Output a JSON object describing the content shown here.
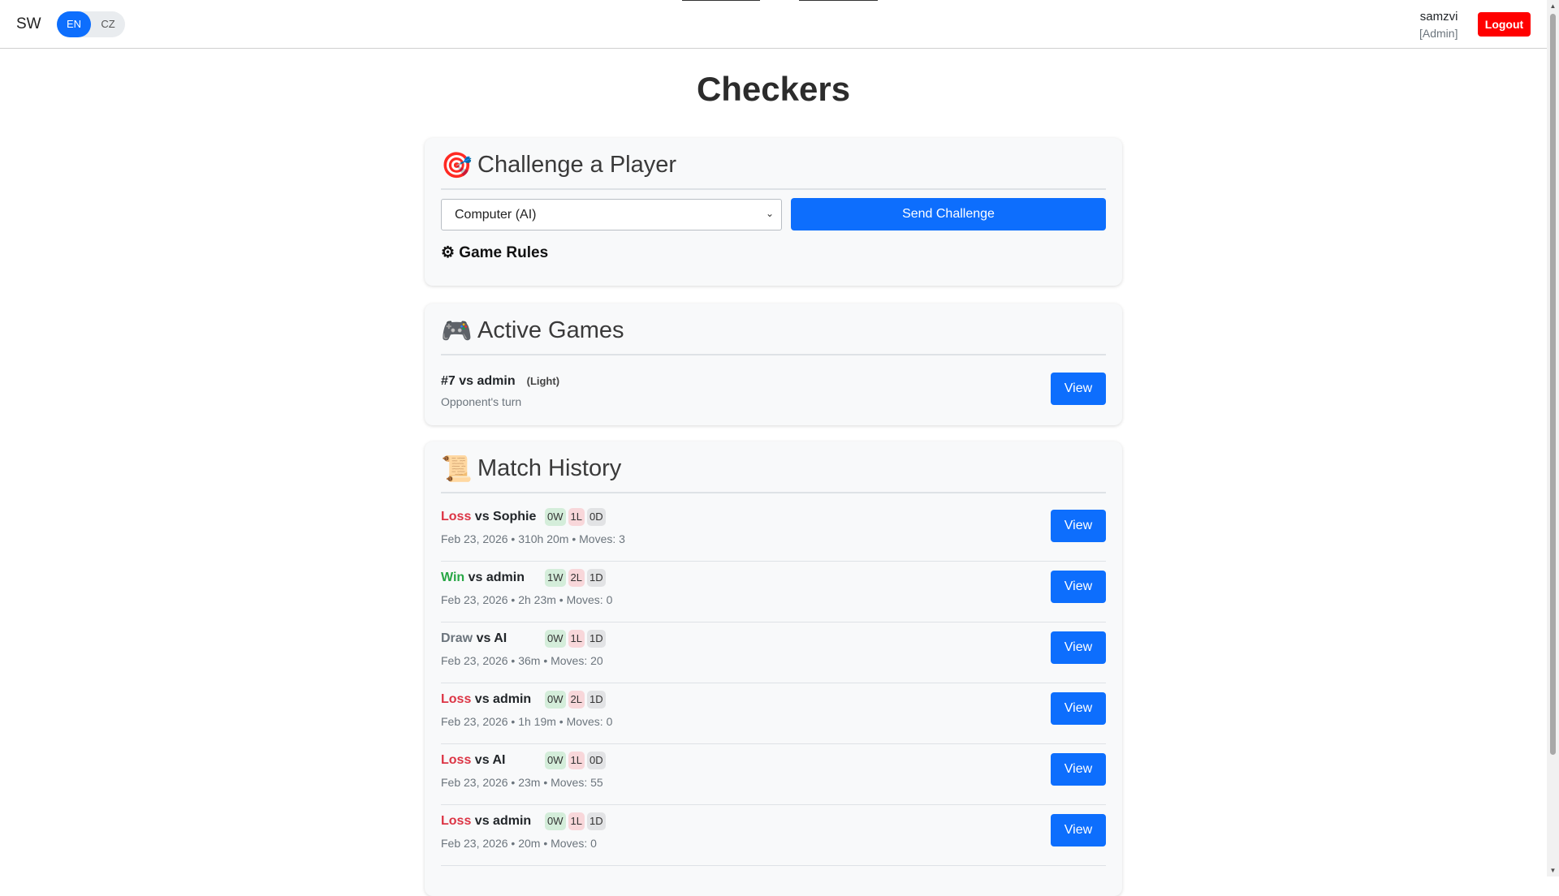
{
  "topbar": {
    "brand": "SW",
    "lang_options": [
      "EN",
      "CZ"
    ],
    "active_lang": "EN",
    "username": "samzvi",
    "role": "[Admin]",
    "logout_label": "Logout"
  },
  "page_title": "Checkers",
  "challenge": {
    "icon": "target-icon",
    "title": "Challenge a Player",
    "selected_opponent": "Computer (AI)",
    "send_label": "Send Challenge",
    "rules_label": "⚙ Game Rules"
  },
  "active_games": {
    "icon": "gamepad-icon",
    "title": "Active Games",
    "items": [
      {
        "label": "#7 vs admin",
        "side": "(Light)",
        "status": "Opponent's turn",
        "view_label": "View"
      }
    ]
  },
  "history": {
    "icon": "scroll-icon",
    "title": "Match History",
    "items": [
      {
        "result": "Loss",
        "opponent": "vs Sophie",
        "w": "0W",
        "l": "1L",
        "d": "0D",
        "meta": "Feb 23, 2026 • 310h 20m • Moves: 3",
        "view_label": "View"
      },
      {
        "result": "Win",
        "opponent": "vs admin",
        "w": "1W",
        "l": "2L",
        "d": "1D",
        "meta": "Feb 23, 2026 • 2h 23m • Moves: 0",
        "view_label": "View"
      },
      {
        "result": "Draw",
        "opponent": "vs AI",
        "w": "0W",
        "l": "1L",
        "d": "1D",
        "meta": "Feb 23, 2026 • 36m • Moves: 20",
        "view_label": "View"
      },
      {
        "result": "Loss",
        "opponent": "vs admin",
        "w": "0W",
        "l": "2L",
        "d": "1D",
        "meta": "Feb 23, 2026 • 1h 19m • Moves: 0",
        "view_label": "View"
      },
      {
        "result": "Loss",
        "opponent": "vs AI",
        "w": "0W",
        "l": "1L",
        "d": "0D",
        "meta": "Feb 23, 2026 • 23m • Moves: 55",
        "view_label": "View"
      },
      {
        "result": "Loss",
        "opponent": "vs admin",
        "w": "0W",
        "l": "1L",
        "d": "1D",
        "meta": "Feb 23, 2026 • 20m • Moves: 0",
        "view_label": "View"
      }
    ]
  },
  "colors": {
    "primary": "#0d6efd",
    "loss": "#dc3545",
    "win": "#28a745",
    "logout": "#ff0000"
  }
}
